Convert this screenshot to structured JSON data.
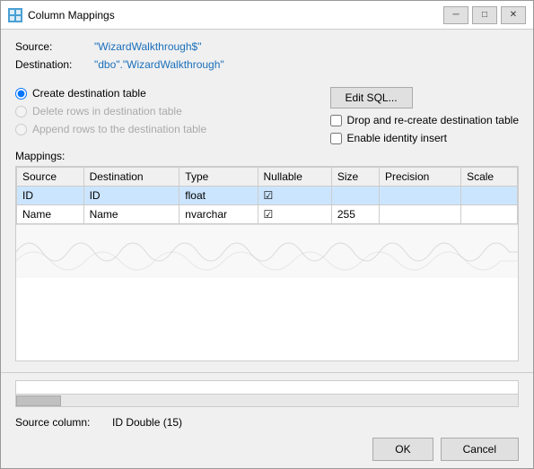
{
  "window": {
    "title": "Column Mappings",
    "icon": "table-icon"
  },
  "titlebar": {
    "minimize_label": "─",
    "maximize_label": "□",
    "close_label": "✕"
  },
  "source": {
    "label": "Source:",
    "value": "\"WizardWalkthrough$\""
  },
  "destination": {
    "label": "Destination:",
    "value": "\"dbo\".\"WizardWalkthrough\""
  },
  "options": {
    "create_destination": {
      "label": "Create destination table",
      "checked": true,
      "disabled": false
    },
    "delete_rows": {
      "label": "Delete rows in destination table",
      "checked": false,
      "disabled": true
    },
    "append_rows": {
      "label": "Append rows to the destination table",
      "checked": false,
      "disabled": true
    },
    "edit_sql_button": "Edit SQL...",
    "drop_recreate": {
      "label": "Drop and re-create destination table",
      "checked": false,
      "disabled": false
    },
    "enable_identity": {
      "label": "Enable identity insert",
      "checked": false,
      "disabled": false
    }
  },
  "mappings": {
    "label": "Mappings:",
    "columns": [
      "Source",
      "Destination",
      "Type",
      "Nullable",
      "Size",
      "Precision",
      "Scale"
    ],
    "rows": [
      {
        "source": "ID",
        "destination": "ID",
        "type": "float",
        "nullable": true,
        "size": "",
        "precision": "",
        "scale": "",
        "selected": true
      },
      {
        "source": "Name",
        "destination": "Name",
        "type": "nvarchar",
        "nullable": true,
        "size": "255",
        "precision": "",
        "scale": "",
        "selected": false
      }
    ]
  },
  "source_column": {
    "label": "Source column:",
    "value": "ID Double (15)"
  },
  "footer": {
    "ok_label": "OK",
    "cancel_label": "Cancel"
  }
}
